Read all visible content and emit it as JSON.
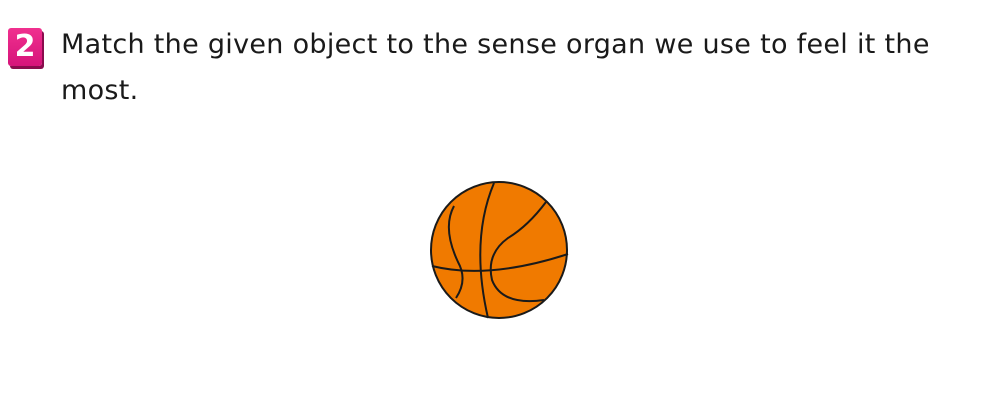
{
  "question": {
    "number": "2",
    "prompt": "Match the given object to the sense organ we use to feel it the most."
  },
  "object": {
    "icon": "basketball-icon",
    "fill_color": "#f07a00",
    "line_color": "#1a1a1a"
  }
}
